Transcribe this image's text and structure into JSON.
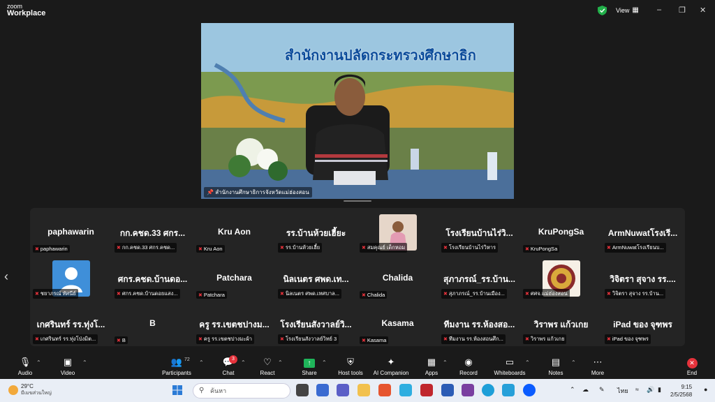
{
  "window": {
    "logo_line1": "zoom",
    "logo_line2": "Workplace",
    "view_label": "View",
    "controls": [
      "–",
      "❐",
      "✕"
    ]
  },
  "main_video": {
    "banner": "สำนักงานปลัดกระทรวงศึกษาธิก",
    "caption": "สำนักงานศึกษาธิการจังหวัดแม่ฮ่องสอน"
  },
  "gallery": [
    {
      "big": "paphawarin",
      "label": "paphawarin"
    },
    {
      "big": "กก.คชด.33 ศกร...",
      "label": "กก.คชด.33 ศกร.คชด..."
    },
    {
      "big": "Kru Aon",
      "label": "Kru Aon"
    },
    {
      "big": "รร.บ้านห้วยเฮี้ยะ",
      "label": "รร.บ้านห้วยเฮี้ย"
    },
    {
      "big": "",
      "label": "สมคุณย์ เด็กหอม"
    },
    {
      "big": "โรงเรียนบ้านไร่วิ...",
      "label": "โรงเรียนบ้านไร่วิหาร"
    },
    {
      "big": "KruPongSa",
      "label": "KruPongSa"
    },
    {
      "big": "ArmNuwatโรงเรี...",
      "label": "ArmNuwatโรงเรียนบ..."
    },
    {
      "big": "",
      "label": "ชยาภรณ์ ทัศนีย์"
    },
    {
      "big": "ศกร.คชด.บ้านดอ...",
      "label": "ศกร.คชด.บ้านดอยแสง..."
    },
    {
      "big": "Patchara",
      "label": "Patchara"
    },
    {
      "big": "นิลเนตร ศพด.เท...",
      "label": "นิลเนตร ศพด.เทศบาล..."
    },
    {
      "big": "Chalida",
      "label": "Chalida"
    },
    {
      "big": "สุภาภรณ์_รร.บ้าน...",
      "label": "สุภาภรณ์_รร.บ้านเมือง..."
    },
    {
      "big": "",
      "label": "ศศจ.แม่ฮ่องสอน"
    },
    {
      "big": "วิจิตรา สุจาง รร....",
      "label": "วิจิตรา สุจาง รร.บ้าน..."
    },
    {
      "big": "เกศรินทร์ รร.ทุ่งโ...",
      "label": "เกศรินทร์ รร.ทุ่งโป่งมิต..."
    },
    {
      "big": "B",
      "label": "B"
    },
    {
      "big": "ครู รร.เขตชปางม...",
      "label": "ครู รร.เขตชปางมะผ้า"
    },
    {
      "big": "โรงเรียนสังวาลย์วิ...",
      "label": "โรงเรียนสังวาลย์วิทย์ 3"
    },
    {
      "big": "Kasama",
      "label": "Kasama"
    },
    {
      "big": "ทีมงาน รร.ห้องสอ...",
      "label": "ทีมงาน รร.ห้องสอนศึก..."
    },
    {
      "big": "วิราพร แก้วเกย",
      "label": "วิราพร แก้วเกย"
    },
    {
      "big": "iPad ของ จุฑพร",
      "label": "iPad ของ จุฑพร"
    }
  ],
  "toolbar": {
    "audio": "Audio",
    "video": "Video",
    "participants": "Participants",
    "participants_count": "72",
    "chat": "Chat",
    "chat_badge": "3",
    "react": "React",
    "share": "Share",
    "host_tools": "Host tools",
    "ai_companion": "AI Companion",
    "apps": "Apps",
    "record": "Record",
    "whiteboards": "Whiteboards",
    "notes": "Notes",
    "more": "More",
    "end": "End"
  },
  "taskbar": {
    "temp": "29°C",
    "weather_desc": "มีเมฆส่วนใหญ่",
    "search_placeholder": "ค้นหา",
    "lang": "ไทย",
    "time": "9:15",
    "date": "2/5/2568"
  },
  "colors": {
    "accent_green": "#22b04a",
    "end_red": "#e5323b",
    "share_green": "#1fb55a"
  }
}
